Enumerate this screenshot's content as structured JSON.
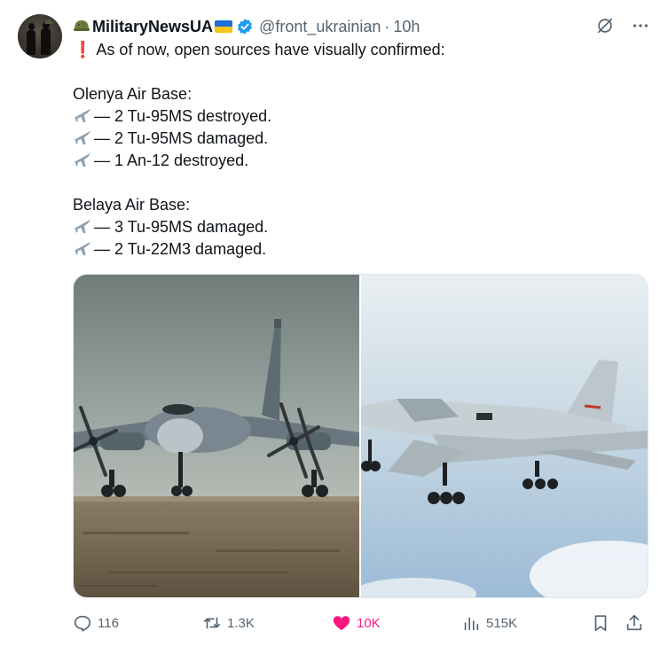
{
  "author": {
    "name": "MilitaryNewsUA",
    "handle": "@front_ukrainian",
    "separator": "·",
    "time": "10h"
  },
  "post": {
    "intro": "❗ As of now, open sources have visually confirmed:",
    "section1_title": "Olenya Air Base:",
    "section1_items": [
      "— 2 Tu-95MS destroyed.",
      "— 2 Tu-95MS damaged.",
      "— 1 An-12 destroyed."
    ],
    "section2_title": "Belaya Air Base:",
    "section2_items": [
      "— 3 Tu-95MS damaged.",
      "— 2 Tu-22M3 damaged."
    ]
  },
  "media": {
    "left_image_icon": "tu-95-bomber-photo",
    "right_image_icon": "tu-22m3-bomber-photo"
  },
  "actions": {
    "replies": "116",
    "reposts": "1.3K",
    "likes": "10K",
    "views": "515K"
  },
  "colors": {
    "verified": "#1d9bf0",
    "like": "#f91880",
    "muted": "#536471"
  }
}
